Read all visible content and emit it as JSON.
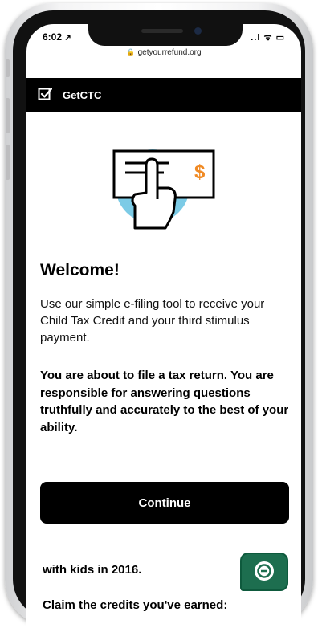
{
  "status_bar": {
    "time": "6:02",
    "time_suffix": "↗",
    "indicators": "..l ᯤ ▭"
  },
  "browser": {
    "url": "getyourrefund.org",
    "lock_icon": "lock-icon"
  },
  "header": {
    "brand": "GetCTC",
    "logo_icon": "checkbox-icon"
  },
  "main": {
    "illustration": "hand-holding-check-icon",
    "title": "Welcome!",
    "intro": "Use our simple e-filing tool to receive your Child Tax Credit and your third stimulus payment.",
    "warning": "You are about to file a tax return. You are responsible for answering questions truthfully and accurately to the best of your ability.",
    "continue_label": "Continue"
  },
  "below_fold": {
    "line1": "with kids in 2016.",
    "line2": "Claim the credits you've earned:"
  },
  "chat_icon": "chat-bubble-icon",
  "colors": {
    "accent_orange": "#f08a24",
    "circle_blue": "#7ccbe6",
    "chat_green": "#1d6e4f"
  }
}
